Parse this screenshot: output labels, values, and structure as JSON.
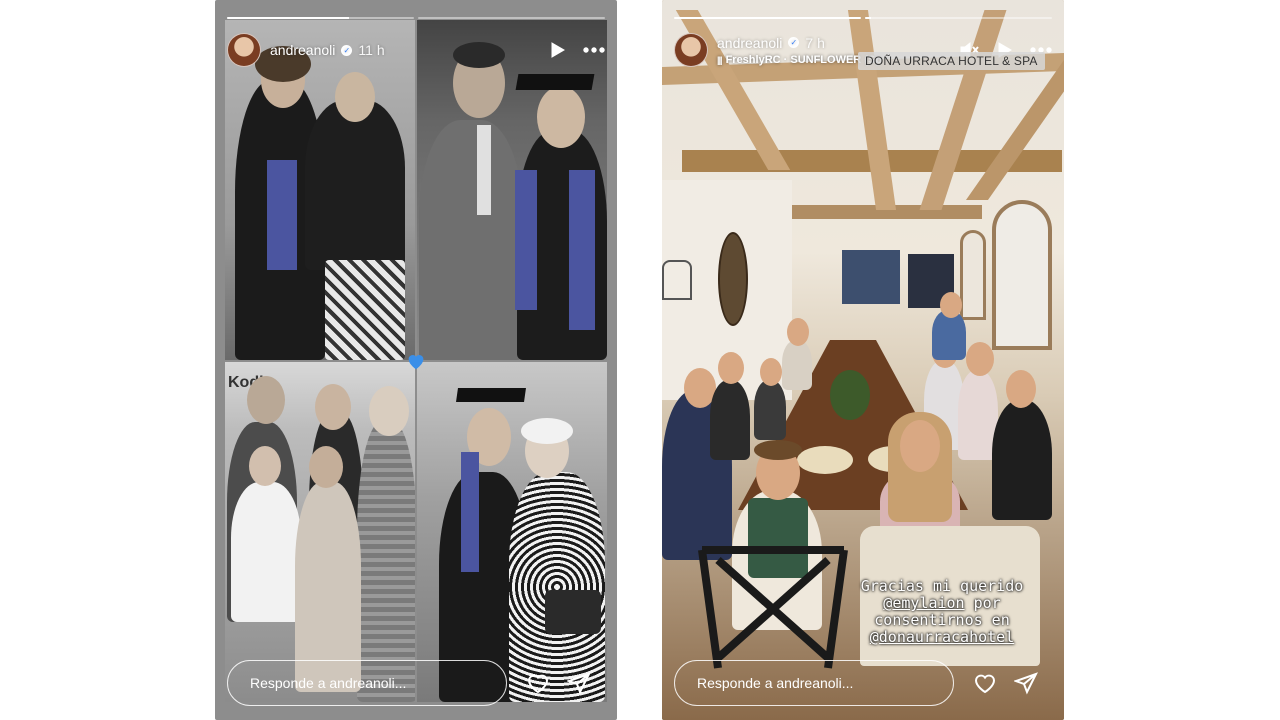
{
  "stories": [
    {
      "username": "andreanoli",
      "time": "11 h",
      "reply_placeholder": "Responde a andreanoli...",
      "sign_text": "Kodi"
    },
    {
      "username": "andreanoli",
      "time": "7 h",
      "music": "FreshlyRC · SUNFLOWER (Sp",
      "location": "DOÑA URRACA HOTEL & SPA",
      "reply_placeholder": "Responde a andreanoli...",
      "caption": {
        "line1": "Gracias mi querido",
        "mention1": "@emylaion",
        "line2_suffix": " por",
        "line3": "consentirnos en",
        "mention2": "@donaurracahotel"
      }
    }
  ],
  "icons": {
    "verified": "verified-badge-icon",
    "play": "play-icon",
    "more": "more-options-icon",
    "mute": "muted-speaker-icon",
    "heart": "blue-heart-icon",
    "like": "heart-outline-icon",
    "share": "send-paper-plane-icon",
    "music": "music-bars-icon"
  },
  "colors": {
    "heart": "#3b8fe8",
    "stole": "#4b55a0"
  }
}
